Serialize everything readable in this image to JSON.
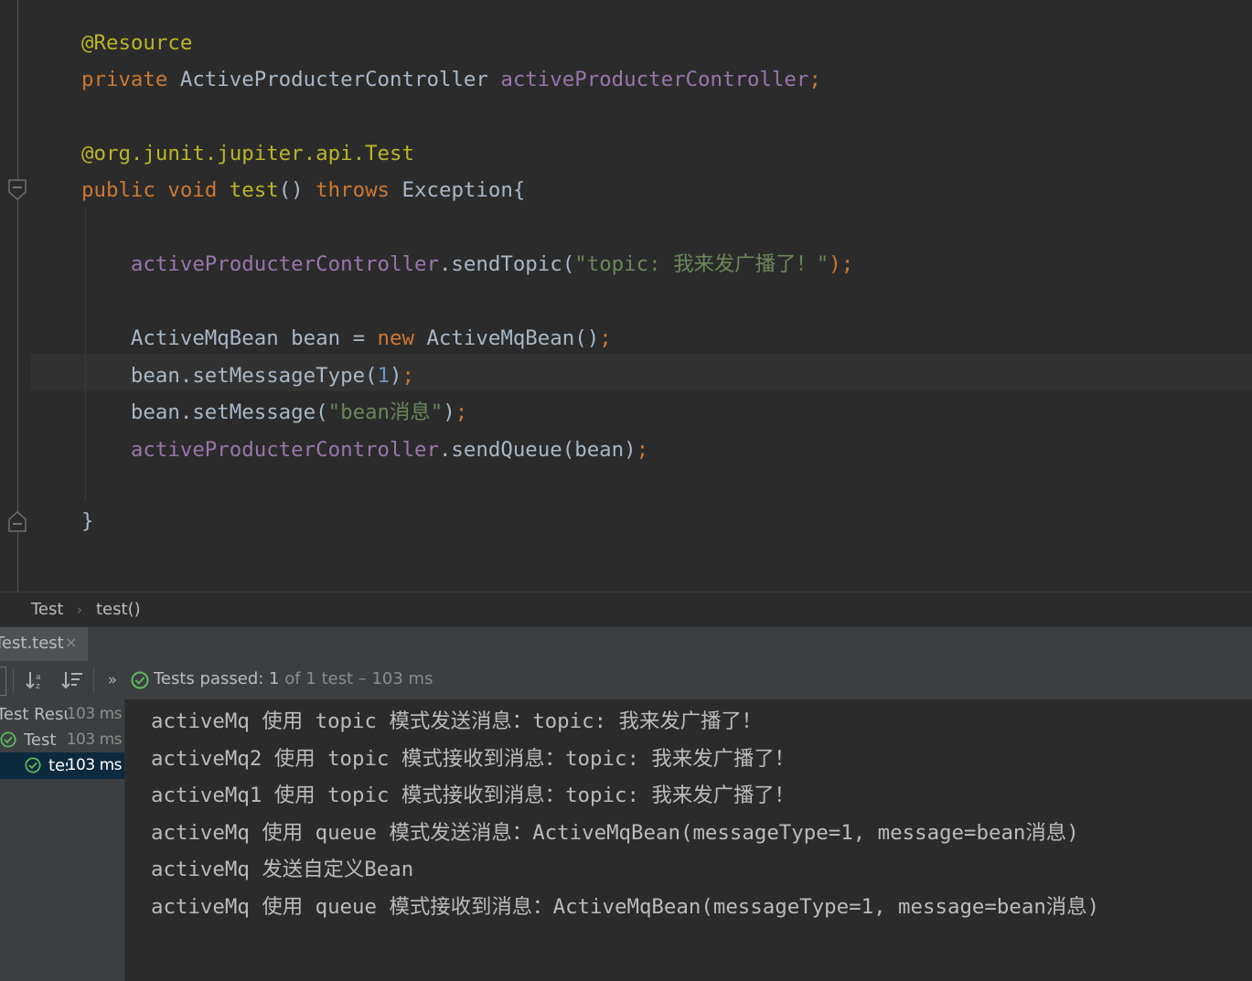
{
  "editor": {
    "lines": [
      [
        {
          "t": "@Resource",
          "c": "ann"
        }
      ],
      [
        {
          "t": "private ",
          "c": "kw"
        },
        {
          "t": "ActiveProducterController ",
          "c": ""
        },
        {
          "t": "activeProducterController",
          "c": "fld"
        },
        {
          "t": ";",
          "c": "punc"
        }
      ],
      [],
      [
        {
          "t": "@org.junit.jupiter.api.",
          "c": "ann"
        },
        {
          "t": "Test",
          "c": "ann"
        }
      ],
      [
        {
          "t": "public ",
          "c": "kw"
        },
        {
          "t": "void ",
          "c": "kw"
        },
        {
          "t": "test",
          "c": "ann"
        },
        {
          "t": "() ",
          "c": ""
        },
        {
          "t": "throws ",
          "c": "kw"
        },
        {
          "t": "Exception{",
          "c": ""
        }
      ],
      [],
      [
        {
          "t": "    ",
          "c": ""
        },
        {
          "t": "activeProducterController",
          "c": "fld"
        },
        {
          "t": ".sendTopic(",
          "c": ""
        },
        {
          "t": "\"topic: 我来发广播了！\"",
          "c": "str"
        },
        {
          "t": ");",
          "c": "punc"
        }
      ],
      [],
      [
        {
          "t": "    ActiveMqBean bean = ",
          "c": ""
        },
        {
          "t": "new ",
          "c": "kw"
        },
        {
          "t": "ActiveMqBean()",
          "c": ""
        },
        {
          "t": ";",
          "c": "punc"
        }
      ],
      [
        {
          "t": "    bean.setMessageType(",
          "c": ""
        },
        {
          "t": "1",
          "c": "num"
        },
        {
          "t": ")",
          "c": ""
        },
        {
          "t": ";",
          "c": "punc"
        }
      ],
      [
        {
          "t": "    bean.setMessage(",
          "c": ""
        },
        {
          "t": "\"bean消息\"",
          "c": "str"
        },
        {
          "t": ")",
          "c": ""
        },
        {
          "t": ";",
          "c": "punc"
        }
      ],
      [
        {
          "t": "    ",
          "c": ""
        },
        {
          "t": "activeProducterController",
          "c": "fld"
        },
        {
          "t": ".sendQueue(bean)",
          "c": ""
        },
        {
          "t": ";",
          "c": "punc"
        }
      ],
      [],
      [],
      [
        {
          "t": "}",
          "c": ""
        }
      ]
    ]
  },
  "breadcrumb": {
    "class_name": "Test",
    "separator": "›",
    "method_name": "test()"
  },
  "run": {
    "tab_label": "Test.test",
    "tab_close": "×",
    "status_main": "Tests passed: 1",
    "status_sub": " of 1 test – 103 ms",
    "tree": [
      {
        "label": "Test Results",
        "duration": "103 ms",
        "indent": -4,
        "check": false,
        "selected": false
      },
      {
        "label": "Test",
        "duration": "103 ms",
        "indent": 18,
        "check": true,
        "selected": false
      },
      {
        "label": "test",
        "duration": "103 ms",
        "indent": 45,
        "check": true,
        "selected": true
      }
    ],
    "console": [
      "activeMq 使用 topic 模式发送消息：topic: 我来发广播了！",
      "activeMq2 使用 topic 模式接收到消息：topic: 我来发广播了！",
      "activeMq1 使用 topic 模式接收到消息：topic: 我来发广播了！",
      "activeMq 使用 queue 模式发送消息：ActiveMqBean(messageType=1, message=bean消息)",
      "activeMq 发送自定义Bean",
      "activeMq 使用 queue 模式接收到消息：ActiveMqBean(messageType=1, message=bean消息)"
    ]
  },
  "colors": {
    "keyword": "#cc7832",
    "annotation": "#bbb529",
    "field": "#9876aa",
    "string": "#6a8759",
    "number": "#6897bb",
    "pass_green": "#5fb85f"
  },
  "icons": {
    "fold_open": "fold-marker-icon",
    "sort_alpha": "sort-alphabetically-icon",
    "sort_duration": "sort-by-duration-icon",
    "more": "more-chevron-icon",
    "passed": "check-circle-icon"
  }
}
